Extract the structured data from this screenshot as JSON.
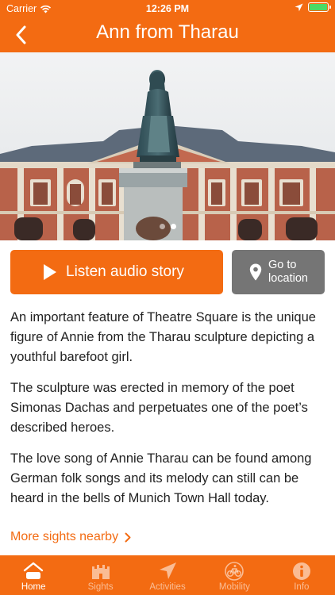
{
  "status_bar": {
    "carrier": "Carrier",
    "time": "12:26 PM"
  },
  "nav": {
    "title": "Ann from Tharau",
    "back_icon": "chevron-left-icon"
  },
  "hero": {
    "slide_count": 2,
    "active_slide": 2
  },
  "actions": {
    "listen_label": "Listen audio story",
    "locate_label_line1": "Go to",
    "locate_label_line2": "location"
  },
  "content": {
    "paragraphs": [
      "An important feature of Theatre Square is the unique figure of Annie from the Tharau sculpture depicting a youthful barefoot girl.",
      "The sculpture was erected in memory of the poet Simonas Dachas and perpetuates one of the poet’s described heroes.",
      "The love song of Annie Tharau can be found among German folk songs and its melody can still can be heard in the bells of Munich Town Hall today."
    ]
  },
  "more_link": {
    "label": "More sights nearby"
  },
  "tabbar": {
    "items": [
      {
        "label": "Home",
        "icon": "home-icon",
        "active": true
      },
      {
        "label": "Sights",
        "icon": "castle-icon",
        "active": false
      },
      {
        "label": "Activities",
        "icon": "navigation-arrow-icon",
        "active": false
      },
      {
        "label": "Mobility",
        "icon": "bicycle-icon",
        "active": false
      },
      {
        "label": "Info",
        "icon": "info-icon",
        "active": false
      }
    ]
  },
  "colors": {
    "accent": "#f36b12",
    "secondary_button": "#757575",
    "battery": "#4cd964"
  }
}
